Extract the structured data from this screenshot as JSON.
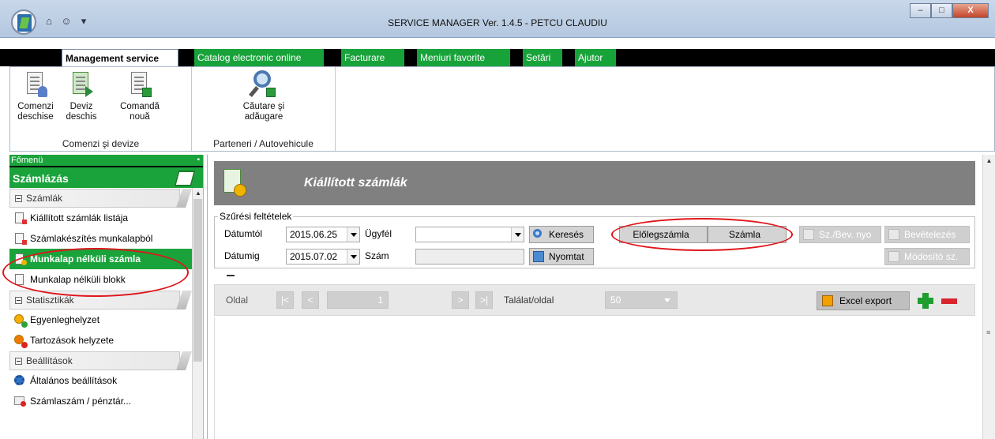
{
  "window": {
    "title": "SERVICE MANAGER Ver. 1.4.5 - PETCU CLAUDIU",
    "minimize": "–",
    "maximize": "□",
    "close": "X"
  },
  "ribbon": {
    "tabs": [
      {
        "label": "Management service"
      },
      {
        "label": "Catalog electronic online"
      },
      {
        "label": "Facturare"
      },
      {
        "label": "Meniuri favorite"
      },
      {
        "label": "Setări"
      },
      {
        "label": "Ajutor"
      }
    ],
    "groups": [
      {
        "title": "Comenzi şi devize",
        "buttons": [
          {
            "line1": "Comenzi",
            "line2": "deschise"
          },
          {
            "line1": "Deviz",
            "line2": "deschis"
          },
          {
            "line1": "Comandă",
            "line2": "nouă"
          }
        ]
      },
      {
        "title": "Parteneri / Autovehicule",
        "buttons": [
          {
            "line1": "Căutare şi",
            "line2": "adăugare"
          }
        ]
      }
    ]
  },
  "leftnav": {
    "header": "Főmenü",
    "section_title": "Számlázás",
    "groups": [
      {
        "label": "Számlák"
      },
      {
        "label": "Statisztikák"
      },
      {
        "label": "Beállítások"
      }
    ],
    "items": [
      {
        "label": "Kiállított számlák listája"
      },
      {
        "label": "Számlakészítés munkalapból"
      },
      {
        "label": "Munkalap nélküli számla"
      },
      {
        "label": "Munkalap nélküli blokk"
      },
      {
        "label": "Egyenleghelyzet"
      },
      {
        "label": "Tartozások helyzete"
      },
      {
        "label": "Általános beállítások"
      },
      {
        "label": "Számlaszám / pénztár..."
      }
    ]
  },
  "main": {
    "page_title": "Kiállított számlák",
    "filters": {
      "legend": "Szűrési feltételek",
      "date_from_label": "Dátumtól",
      "date_from_value": "2015.06.25",
      "date_to_label": "Dátumig",
      "date_to_value": "2015.07.02",
      "client_label": "Ügyfél",
      "client_value": "",
      "number_label": "Szám",
      "number_value": "",
      "search_button": "Keresés",
      "print_button": "Nyomtat",
      "advance_invoice_button": "Előlegszámla",
      "invoice_button": "Számla",
      "receipt_button": "Sz./Bev. nyo",
      "cash_in_button": "Bevételezés",
      "modify_button": "Módosító sz."
    },
    "pager": {
      "page_label": "Oldal",
      "first": "|<",
      "prev": "<",
      "page_value": "1",
      "next": ">",
      "last": ">|",
      "per_page_label": "Találat/oldal",
      "per_page_value": "50",
      "excel_button": "Excel export"
    }
  }
}
